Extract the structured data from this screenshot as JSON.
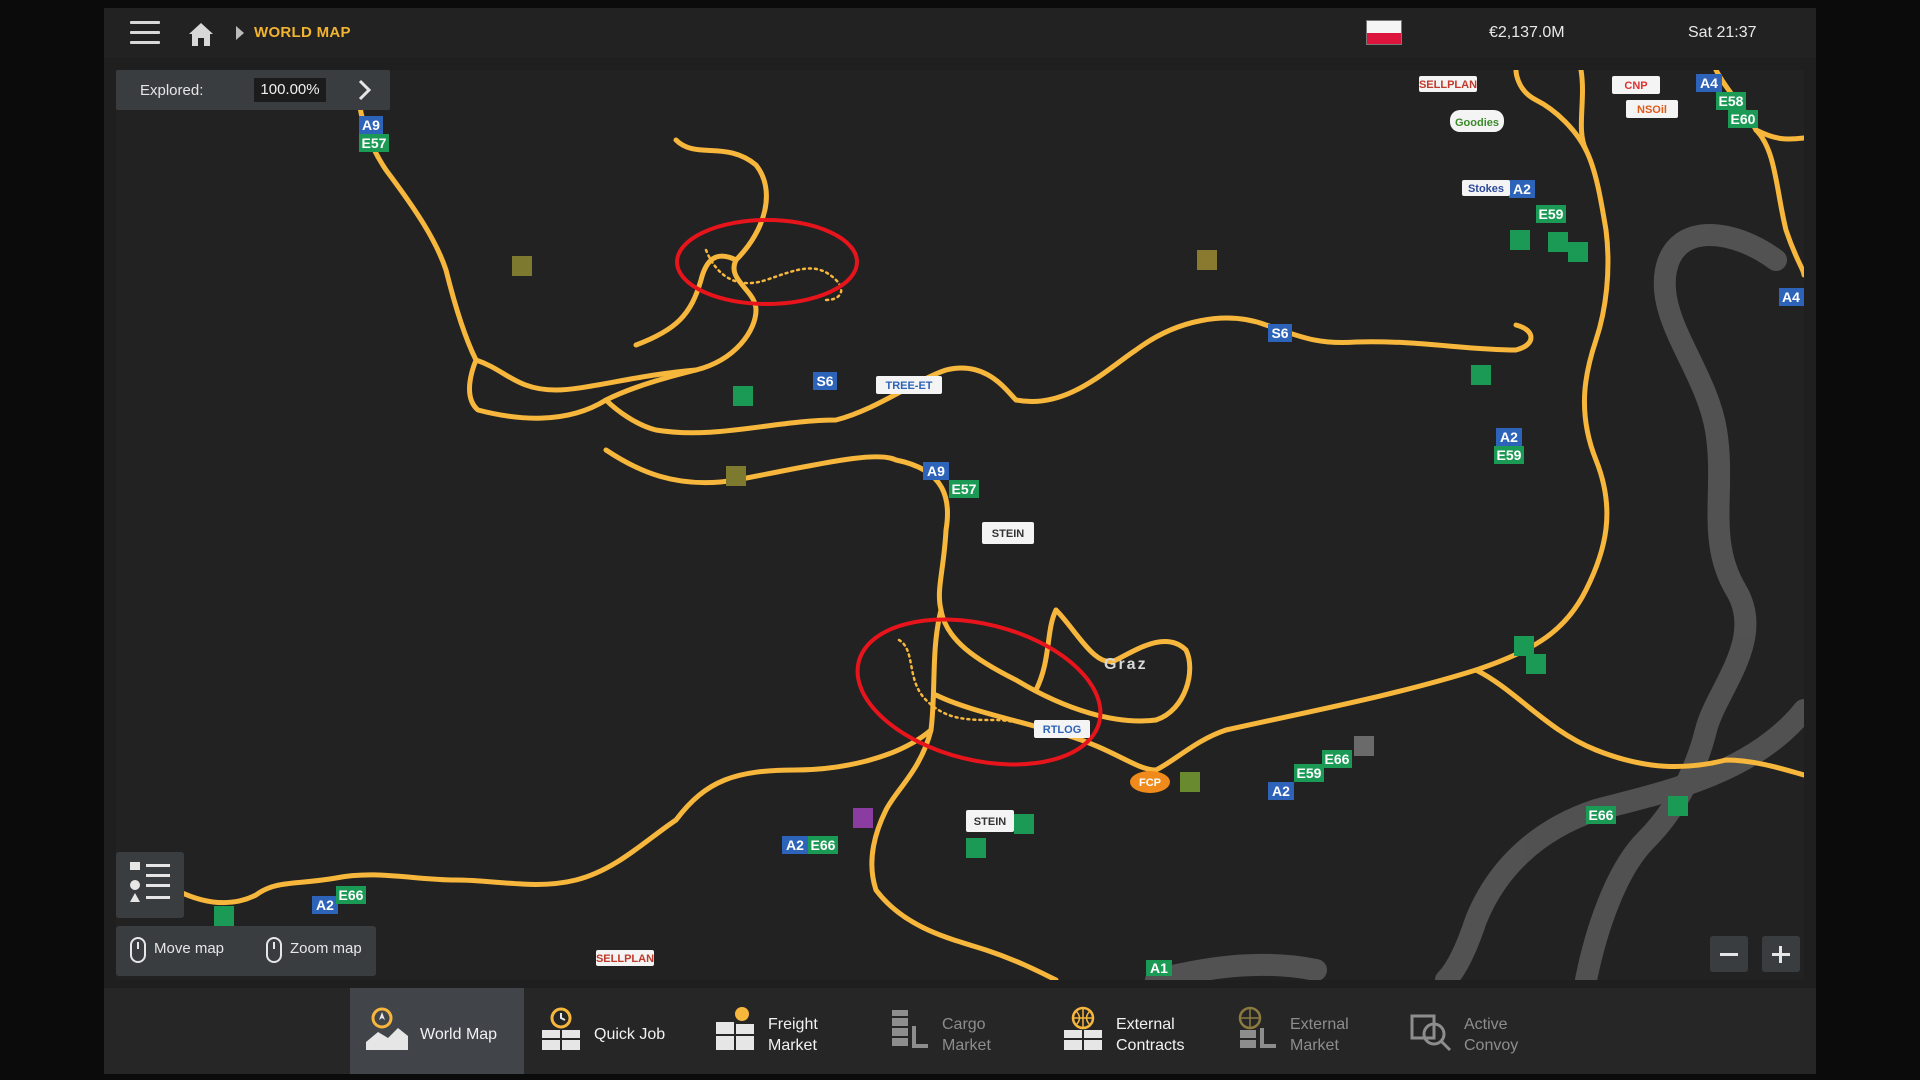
{
  "header": {
    "breadcrumb": "WORLD MAP",
    "money": "€2,137.0M",
    "time": "Sat 21:37"
  },
  "map": {
    "explored_label": "Explored:",
    "explored_value": "100.00%",
    "city": "Graz",
    "road_labels": [
      "A9",
      "E57",
      "S6",
      "A9",
      "E57",
      "A2",
      "E59",
      "A4",
      "E58",
      "E60",
      "A2",
      "E59",
      "A4",
      "S6",
      "A2",
      "E59",
      "E66",
      "A2",
      "E66",
      "A2",
      "E66",
      "E66",
      "A1"
    ],
    "company_labels": [
      "SELLPLAN",
      "Euro Goodies",
      "Stokes",
      "CNP",
      "NSOil",
      "TREE-ET",
      "STEIN BRUCH",
      "RTLOG",
      "FCP",
      "STEIN BRUCH",
      "SELLPLAN"
    ],
    "hints": {
      "move": "Move map",
      "zoom": "Zoom map"
    },
    "colors": {
      "road": "#f6b73c",
      "highlight": "#e8141c",
      "background": "#222222"
    }
  },
  "tabs": [
    {
      "line1": "World Map",
      "line2": "",
      "active": true
    },
    {
      "line1": "Quick Job",
      "line2": "",
      "active": false
    },
    {
      "line1": "Freight",
      "line2": "Market",
      "active": false
    },
    {
      "line1": "Cargo",
      "line2": "Market",
      "active": false,
      "dim": true
    },
    {
      "line1": "External",
      "line2": "Contracts",
      "active": false
    },
    {
      "line1": "External",
      "line2": "Market",
      "active": false,
      "dim": true
    },
    {
      "line1": "Active",
      "line2": "Convoy",
      "active": false,
      "dim": true
    }
  ]
}
